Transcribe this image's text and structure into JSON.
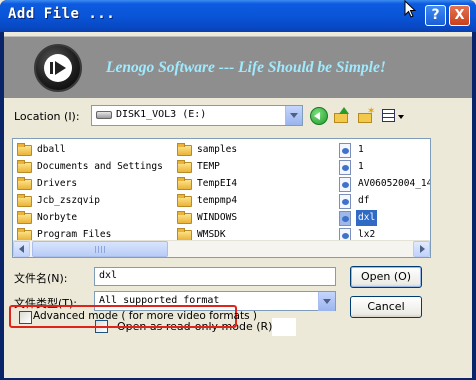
{
  "window": {
    "title": "Add File ...",
    "help_glyph": "?",
    "close_glyph": "X"
  },
  "banner": {
    "slogan": "Lenogo Software  ---  Life Should be Simple!"
  },
  "location": {
    "label": "Location (I):",
    "value": "DISK1_VOL3 (E:)"
  },
  "toolbar": {
    "icons": [
      "back-icon",
      "up-folder-icon",
      "new-folder-icon",
      "view-menu-icon"
    ]
  },
  "files": {
    "col1": [
      "dball",
      "Documents and Settings",
      "Drivers",
      "Jcb_zszqvip",
      "Norbyte",
      "Program Files"
    ],
    "col2": [
      "samples",
      "TEMP",
      "TempEI4",
      "tempmp4",
      "WINDOWS",
      "WMSDK"
    ],
    "col3": [
      "1",
      "1",
      "AV06052004_14",
      "df",
      "dxl",
      "lx2"
    ],
    "selected": "dxl"
  },
  "filename": {
    "label": "文件名(N):",
    "value": "dxl"
  },
  "filetype": {
    "label": "文件类型(T):",
    "value": "All supported format"
  },
  "buttons": {
    "open": "Open (O)",
    "cancel": "Cancel"
  },
  "readonly": {
    "label": "Open as read-only mode (R)"
  },
  "advanced": {
    "label": "Advanced mode ( for more video formats )"
  }
}
